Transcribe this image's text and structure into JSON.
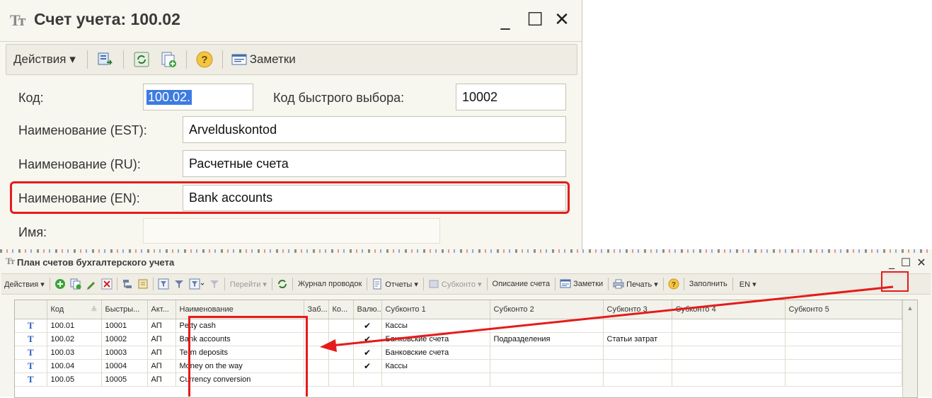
{
  "dialog": {
    "title": "Счет учета: 100.02",
    "title_icon": "Тт",
    "toolbar": {
      "actions_label": "Действия",
      "notes_label": "Заметки",
      "help_glyph": "?"
    },
    "fields": {
      "code_label": "Код:",
      "code_value": "100.02.",
      "quick_label": "Код быстрого выбора:",
      "quick_value": "10002",
      "name_est_label": "Наименование (EST):",
      "name_est_value": "Arvelduskontod",
      "name_ru_label": "Наименование (RU):",
      "name_ru_value": "Расчетные счета",
      "name_en_label": "Наименование (EN):",
      "name_en_value": "Bank accounts",
      "name_label": "Имя:",
      "name_value": ""
    }
  },
  "list": {
    "title": "План счетов бухгалтерского учета",
    "title_icon": "Тт",
    "toolbar": {
      "actions": "Действия",
      "go": "Перейти",
      "journal": "Журнал проводок",
      "reports": "Отчеты",
      "subconto": "Субконто",
      "description": "Описание счета",
      "notes": "Заметки",
      "print": "Печать",
      "help": "?",
      "fill": "Заполнить",
      "lang": "EN"
    },
    "columns": [
      "",
      "Код",
      "Быстры...",
      "Акт...",
      "Наименование",
      "Заб...",
      "Ко...",
      "Валю...",
      "Субконто 1",
      "Субконто 2",
      "Субконто 3",
      "Субконто 4",
      "Субконто 5"
    ],
    "rows": [
      {
        "icon": "Т",
        "code": "100.01",
        "quick": "10001",
        "act": "АП",
        "name": "Petty cash",
        "zab": "",
        "ko": "",
        "val": "✔",
        "s1": "Кассы",
        "s2": "",
        "s3": "",
        "s4": "",
        "s5": ""
      },
      {
        "icon": "Т",
        "code": "100.02",
        "quick": "10002",
        "act": "АП",
        "name": "Bank accounts",
        "zab": "",
        "ko": "",
        "val": "✔",
        "s1": "Банковские счета",
        "s2": "Подразделения",
        "s3": "Статьи затрат",
        "s4": "",
        "s5": ""
      },
      {
        "icon": "Т",
        "code": "100.03",
        "quick": "10003",
        "act": "АП",
        "name": "Term deposits",
        "zab": "",
        "ko": "",
        "val": "✔",
        "s1": "Банковские счета",
        "s2": "",
        "s3": "",
        "s4": "",
        "s5": ""
      },
      {
        "icon": "Т",
        "code": "100.04",
        "quick": "10004",
        "act": "АП",
        "name": "Money on the way",
        "zab": "",
        "ko": "",
        "val": "✔",
        "s1": "Кассы",
        "s2": "",
        "s3": "",
        "s4": "",
        "s5": ""
      },
      {
        "icon": "Т",
        "code": "100.05",
        "quick": "10005",
        "act": "АП",
        "name": "Currency conversion",
        "zab": "",
        "ko": "",
        "val": "",
        "s1": "",
        "s2": "",
        "s3": "",
        "s4": "",
        "s5": ""
      }
    ]
  },
  "colors": {
    "highlight": "#e51b1b",
    "window_bg": "#f7f6ef",
    "selection": "#3d7be0"
  }
}
